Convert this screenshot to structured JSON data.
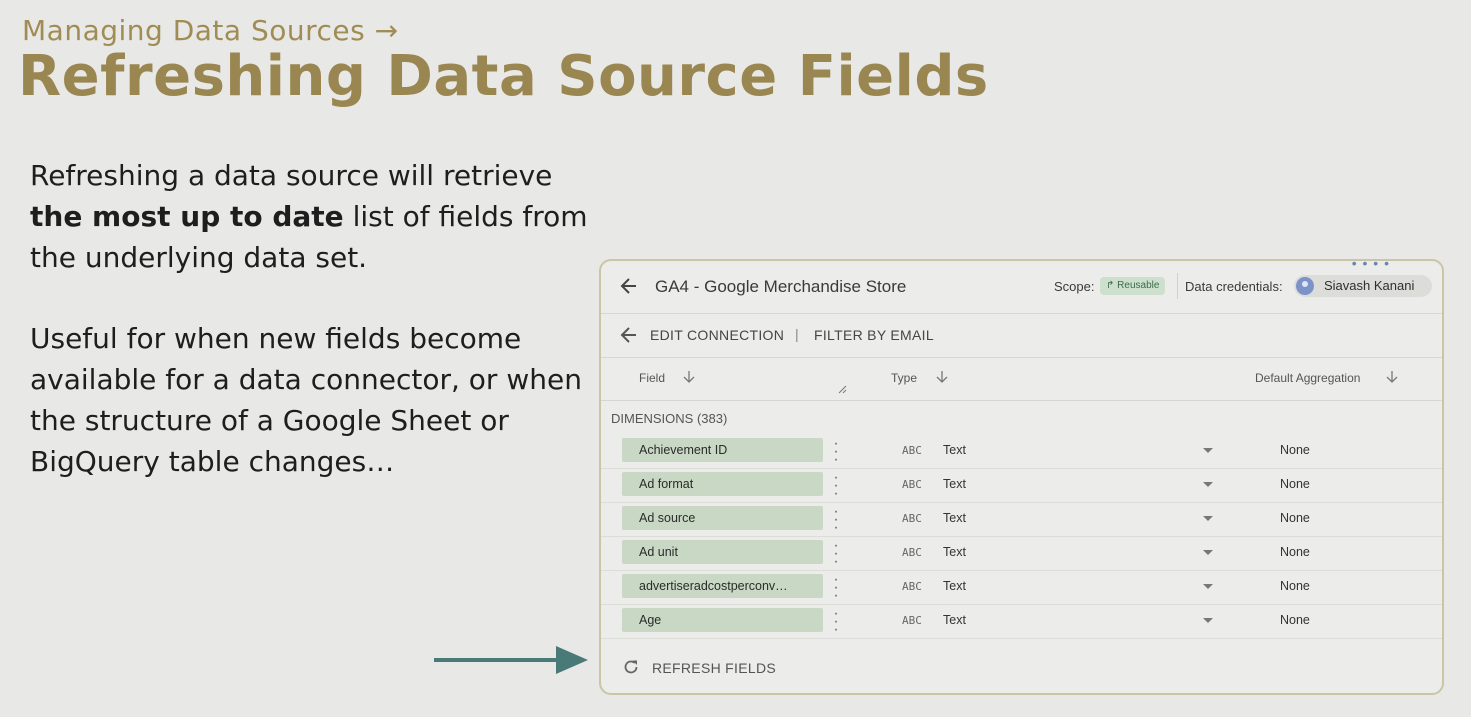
{
  "slide": {
    "kicker": "Managing Data Sources →",
    "title": "Refreshing Data Source Fields",
    "para1": {
      "pre": "Refreshing a data source will retrieve ",
      "bold": "the most up to date",
      "post": " list of fields from the underlying data set."
    },
    "para2": "Useful for when new fields become available for a data connector, or when the structure of a Google Sheet or BigQuery table changes…",
    "arrow_color": "#4a7a78",
    "accent_color": "#9a8650"
  },
  "panel": {
    "title": "GA4 - Google Merchandise Store",
    "scope_label": "Scope:",
    "scope_value": "Reusable",
    "credentials_label": "Data credentials:",
    "credentials_user": "Siavash Kanani",
    "toolbar": {
      "edit_connection": "EDIT CONNECTION",
      "separator": "|",
      "filter_by_email": "FILTER BY EMAIL"
    },
    "columns": {
      "field": "Field",
      "type": "Type",
      "aggregation": "Default Aggregation"
    },
    "dimensions_label": "DIMENSIONS (383)",
    "rows": [
      {
        "field": "Achievement ID",
        "type_icon": "ABC",
        "type": "Text",
        "aggregation": "None"
      },
      {
        "field": "Ad format",
        "type_icon": "ABC",
        "type": "Text",
        "aggregation": "None"
      },
      {
        "field": "Ad source",
        "type_icon": "ABC",
        "type": "Text",
        "aggregation": "None"
      },
      {
        "field": "Ad unit",
        "type_icon": "ABC",
        "type": "Text",
        "aggregation": "None"
      },
      {
        "field": "advertiseradcostperconv…",
        "type_icon": "ABC",
        "type": "Text",
        "aggregation": "None"
      },
      {
        "field": "Age",
        "type_icon": "ABC",
        "type": "Text",
        "aggregation": "None"
      }
    ],
    "refresh_label": "REFRESH FIELDS",
    "chip_color": "#c8d8c4"
  }
}
